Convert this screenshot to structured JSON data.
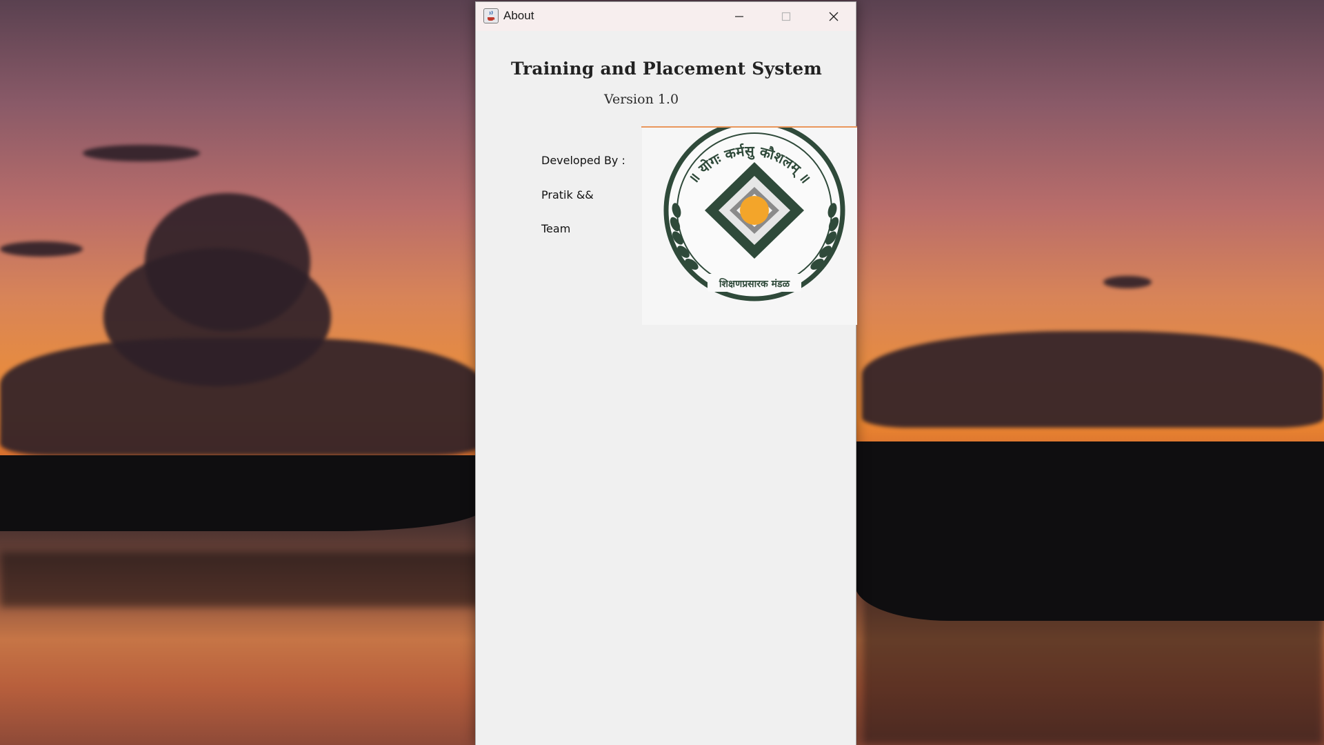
{
  "window": {
    "title": "About",
    "app_icon": "java-cup-icon",
    "controls": {
      "minimize": "minimize-icon",
      "maximize": "maximize-icon",
      "close": "close-icon"
    }
  },
  "about": {
    "heading": "Training and Placement System",
    "version": "Version 1.0",
    "developed_by_label": "Developed By :",
    "developer_line1": "Pratik &&",
    "developer_line2": "Team"
  },
  "logo": {
    "top_text": "॥ योगः कर्मसु कौशलम् ॥",
    "bottom_text": "शिक्षणप्रसारक मंडळ"
  },
  "colors": {
    "window_bg": "#f0f0f0",
    "titlebar_bg": "#f7eeee",
    "divider": "#e9965a",
    "logo_green": "#2f4a3a",
    "logo_orange": "#f3a52a"
  }
}
